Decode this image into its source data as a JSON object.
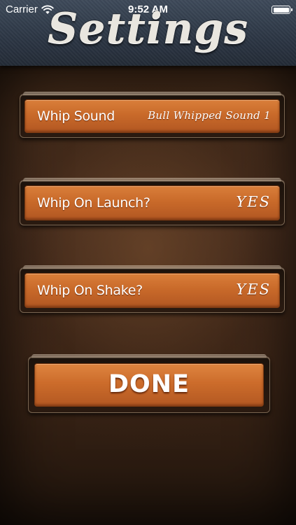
{
  "status_bar": {
    "carrier": "Carrier",
    "time": "9:52 AM",
    "wifi_icon": "wifi-icon",
    "battery_icon": "battery-icon",
    "battery_level": 1.0
  },
  "header": {
    "title": "Settings"
  },
  "settings": [
    {
      "label": "Whip Sound",
      "value": "Bull Whipped Sound 1"
    },
    {
      "label": "Whip On Launch?",
      "value": "YES"
    },
    {
      "label": "Whip On Shake?",
      "value": "YES"
    }
  ],
  "done_button": {
    "label": "DONE"
  },
  "colors": {
    "button_orange": "#c96a2a",
    "leather_brown": "#3d2717",
    "header_slate": "#2c3644",
    "text_white": "#ffffff"
  }
}
